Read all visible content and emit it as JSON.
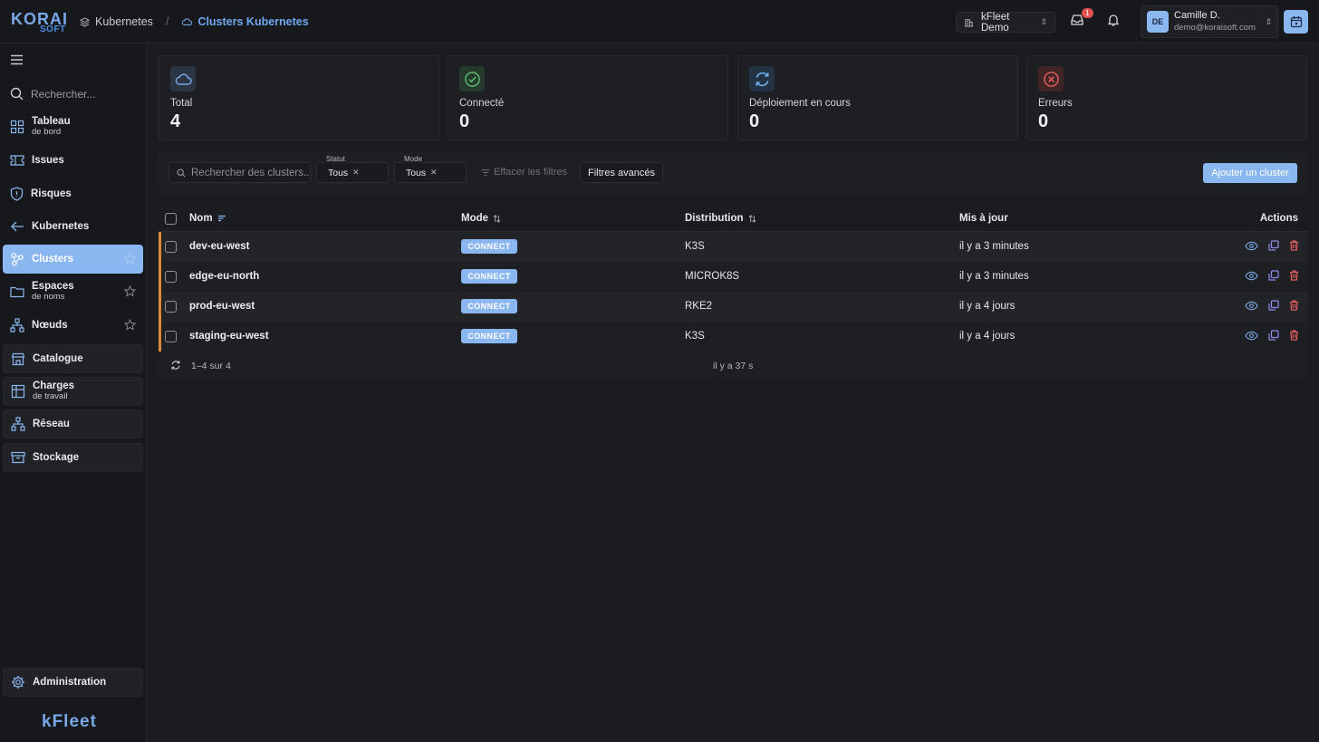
{
  "brand": {
    "logo_top": "KORAI",
    "logo_bottom": "SOFT",
    "footer": "kFleet"
  },
  "breadcrumb": [
    {
      "label": "Kubernetes",
      "icon": "layers-icon"
    },
    {
      "label": "Clusters Kubernetes",
      "icon": "cloud-icon"
    }
  ],
  "breadcrumb_sep": "/",
  "header": {
    "org": "kFleet Demo",
    "inbox_badge": "1",
    "user": {
      "initials": "DE",
      "name": "Camille D.",
      "email": "demo@koraisoft.com"
    }
  },
  "sidebar": {
    "search_placeholder": "Rechercher...",
    "items": [
      {
        "label": "Tableau",
        "sub": "de bord",
        "icon": "dashboard-icon"
      },
      {
        "label": "Issues",
        "sub": "",
        "icon": "ticket-icon"
      },
      {
        "label": "Risques",
        "sub": "",
        "icon": "shield-icon"
      },
      {
        "label": "Kubernetes",
        "sub": "",
        "icon": "back-arrow-icon"
      },
      {
        "label": "Clusters",
        "sub": "",
        "icon": "cluster-icon"
      },
      {
        "label": "Espaces",
        "sub": "de noms",
        "icon": "folder-icon"
      },
      {
        "label": "Nœuds",
        "sub": "",
        "icon": "network-icon"
      },
      {
        "label": "Catalogue",
        "sub": "",
        "icon": "store-icon"
      },
      {
        "label": "Charges",
        "sub": "de travail",
        "icon": "grid-icon"
      },
      {
        "label": "Réseau",
        "sub": "",
        "icon": "network-icon"
      },
      {
        "label": "Stockage",
        "sub": "",
        "icon": "archive-icon"
      }
    ],
    "admin": {
      "label": "Administration",
      "icon": "gear-icon"
    }
  },
  "stats": [
    {
      "label": "Total",
      "value": "4",
      "icon": "cloud-icon",
      "color": "#7aa7e8"
    },
    {
      "label": "Connecté",
      "value": "0",
      "icon": "check-circle-icon",
      "color": "#5bbf73"
    },
    {
      "label": "Déploiement en cours",
      "value": "0",
      "icon": "sync-icon",
      "color": "#6fb4f2"
    },
    {
      "label": "Erreurs",
      "value": "0",
      "icon": "x-circle-icon",
      "color": "#e25d5d"
    }
  ],
  "filters": {
    "search_placeholder": "Rechercher des clusters...",
    "status": {
      "label": "Statut",
      "value": "Tous"
    },
    "mode": {
      "label": "Mode",
      "value": "Tous"
    },
    "clear_label": "Effacer les filtres",
    "advanced_label": "Filtres avancés",
    "add_label": "Ajouter un cluster"
  },
  "table": {
    "columns": {
      "name": "Nom",
      "mode": "Mode",
      "distribution": "Distribution",
      "updated": "Mis à jour",
      "actions": "Actions"
    },
    "rows": [
      {
        "name": "dev-eu-west",
        "mode": "CONNECT",
        "distribution": "K3S",
        "updated": "il y a 3 minutes"
      },
      {
        "name": "edge-eu-north",
        "mode": "CONNECT",
        "distribution": "MICROK8S",
        "updated": "il y a 3 minutes"
      },
      {
        "name": "prod-eu-west",
        "mode": "CONNECT",
        "distribution": "RKE2",
        "updated": "il y a 4 jours"
      },
      {
        "name": "staging-eu-west",
        "mode": "CONNECT",
        "distribution": "K3S",
        "updated": "il y a 4 jours"
      }
    ],
    "footer": {
      "pagination": "1–4 sur 4",
      "refreshed": "il y a 37 s"
    }
  },
  "colors": {
    "accent": "#8bb7f0",
    "row_marker": "#d98a3a",
    "danger": "#e25d5d"
  }
}
